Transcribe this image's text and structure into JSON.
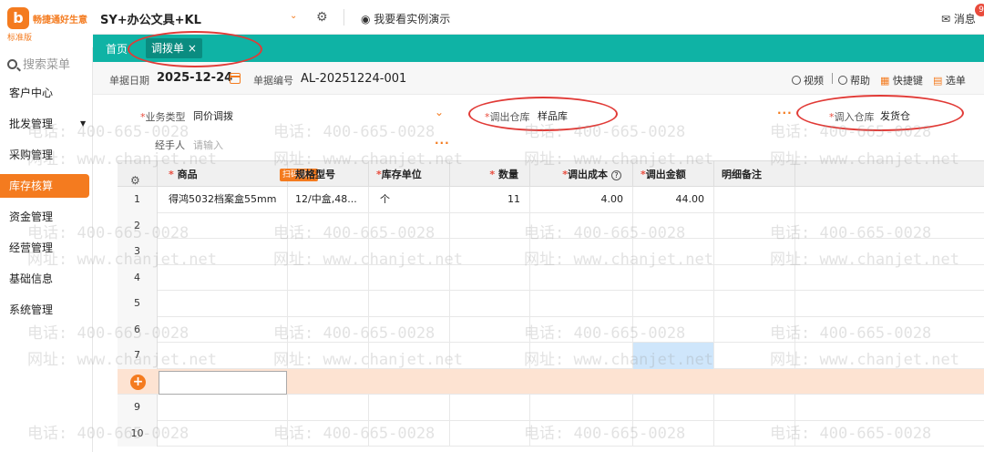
{
  "app": {
    "logo_text": "畅捷通好生意",
    "logo_sub": "标准版",
    "company": "SY+办公文具+KL",
    "demo_label": "我要看实例演示",
    "messages_label": "消息",
    "messages_count": "9"
  },
  "sidebar": {
    "search_placeholder": "搜索菜单",
    "items": [
      {
        "label": "客户中心"
      },
      {
        "label": "批发管理"
      },
      {
        "label": "采购管理"
      },
      {
        "label": "库存核算"
      },
      {
        "label": "资金管理"
      },
      {
        "label": "经营管理"
      },
      {
        "label": "基础信息"
      },
      {
        "label": "系统管理"
      }
    ]
  },
  "tabs": {
    "home": "首页",
    "active": "调拨单 ×"
  },
  "form": {
    "date_label": "单据日期",
    "date_value": "2025-12-24",
    "number_label": "单据编号",
    "number_value": "AL-20251224-001",
    "toolbar": {
      "video": "视频",
      "help": "帮助",
      "shortcut": "快捷键",
      "select": "选单"
    },
    "business_type_label": "业务类型",
    "business_type_value": "同价调拨",
    "out_warehouse_label": "调出仓库",
    "out_warehouse_value": "样品库",
    "in_warehouse_label": "调入仓库",
    "in_warehouse_value": "发货仓",
    "handler_label": "经手人",
    "handler_placeholder": "请输入",
    "required_mark": "*",
    "more_dots": "···"
  },
  "grid": {
    "headers": {
      "product": "商品",
      "scan": "扫码录入",
      "spec": "规格型号",
      "unit": "库存单位",
      "qty": "数量",
      "cost": "调出成本",
      "amount": "调出金额",
      "remark": "明细备注"
    },
    "rows": [
      {
        "num": "1",
        "product": "得鸿5032档案盒55mm",
        "spec": "12/中盒,48...",
        "unit": "个",
        "qty": "11",
        "cost": "4.00",
        "amount": "44.00",
        "remark": ""
      },
      {
        "num": "2"
      },
      {
        "num": "3"
      },
      {
        "num": "4"
      },
      {
        "num": "5"
      },
      {
        "num": "6"
      },
      {
        "num": "7"
      }
    ],
    "after_rows": [
      {
        "num": "9"
      },
      {
        "num": "10"
      }
    ]
  },
  "watermark": {
    "phone": "电话: 400-665-0028",
    "site": "网址: www.chanjet.net"
  }
}
